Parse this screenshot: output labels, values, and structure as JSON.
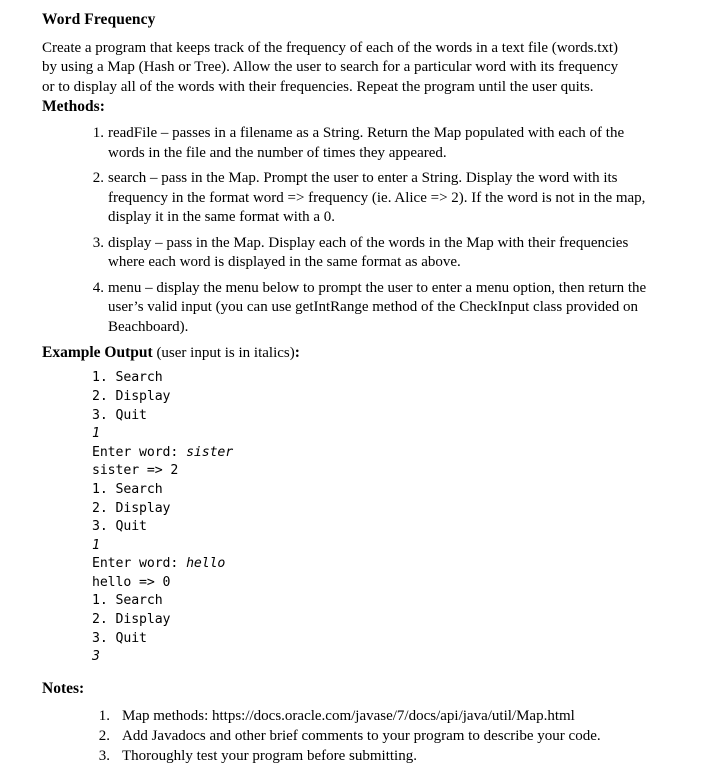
{
  "document": {
    "title": "Word Frequency",
    "intro": "Create a program that keeps track of the frequency of each of the words in a text file (words.txt) by using a Map (Hash or Tree).  Allow the user to search for a particular word with its frequency or to display all of the words with their frequencies.  Repeat the program until the user quits."
  },
  "methods": {
    "heading": "Methods:",
    "items": [
      "readFile – passes in a filename as a String.  Return the Map populated with each of the words in the file and the number of times they appeared.",
      "search – pass in the Map.  Prompt the user to enter a String.  Display the word with its frequency in the format word => frequency (ie. Alice => 2).  If the word is not in the map, display it in the same format with a 0.",
      "display – pass in the Map.  Display each of the words in the Map with their frequencies where each word is displayed in the same format as above.",
      "menu – display the menu below to prompt the user to enter a menu option, then return the user’s valid input (you can use getIntRange method of the CheckInput class provided on Beachboard)."
    ]
  },
  "example_output": {
    "heading": "Example Output",
    "heading_note": " (user input is in italics)",
    "heading_colon": ":",
    "lines": [
      {
        "static": "1. Search",
        "italic": ""
      },
      {
        "static": "2. Display",
        "italic": ""
      },
      {
        "static": "3. Quit",
        "italic": ""
      },
      {
        "static": "",
        "italic": "1"
      },
      {
        "static": "Enter word: ",
        "italic": "sister"
      },
      {
        "static": "sister => 2",
        "italic": ""
      },
      {
        "static": "1. Search",
        "italic": ""
      },
      {
        "static": "2. Display",
        "italic": ""
      },
      {
        "static": "3. Quit",
        "italic": ""
      },
      {
        "static": "",
        "italic": "1"
      },
      {
        "static": "Enter word: ",
        "italic": "hello"
      },
      {
        "static": "hello => 0",
        "italic": ""
      },
      {
        "static": "1. Search",
        "italic": ""
      },
      {
        "static": "2. Display",
        "italic": ""
      },
      {
        "static": "3. Quit",
        "italic": ""
      },
      {
        "static": "",
        "italic": "3"
      }
    ]
  },
  "notes": {
    "heading": "Notes:",
    "items": [
      "Map methods: https://docs.oracle.com/javase/7/docs/api/java/util/Map.html",
      "Add Javadocs and other brief comments to your program to describe your code.",
      "Thoroughly test your program before submitting."
    ]
  }
}
